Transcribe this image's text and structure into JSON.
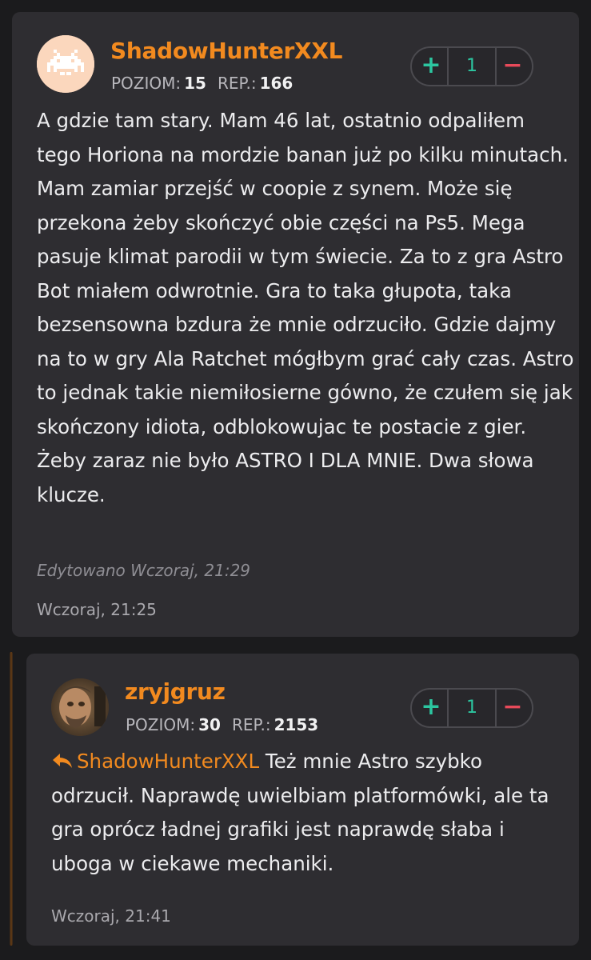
{
  "comments": [
    {
      "username": "ShadowHunterXXL",
      "avatar_icon": "space-invader-icon",
      "level_label": "POZIOM:",
      "level": "15",
      "rep_label": "REP.:",
      "rep": "166",
      "vote_count": "1",
      "vote_plus": "+",
      "vote_minus": "−",
      "text": "A gdzie tam stary. Mam 46 lat, ostatnio odpaliłem tego Horiona na mordzie banan już po kilku minutach. Mam zamiar przejść w coopie z synem. Może się przekona żeby skończyć obie części na Ps5. Mega pasuje klimat parodii w tym świecie. Za to z gra Astro Bot miałem odwrotnie. Gra to taka głupota, taka bezsensowna bzdura że mnie odrzuciło. Gdzie dajmy na to w gry Ala Ratchet mógłbym grać cały czas. Astro to jednak takie niemiłosierne gówno, że czułem się jak skończony idiota, odblokowujac te postacie z gier. Żeby zaraz nie było ASTRO I DLA MNIE. Dwa słowa klucze.",
      "edited": "Edytowano Wczoraj, 21:29",
      "timestamp": "Wczoraj, 21:25"
    },
    {
      "username": "zryjgruz",
      "avatar_icon": "user-photo-avatar",
      "level_label": "POZIOM:",
      "level": "30",
      "rep_label": "REP.:",
      "rep": "2153",
      "vote_count": "1",
      "vote_plus": "+",
      "vote_minus": "−",
      "reply_icon": "reply-arrow-icon",
      "reply_to": "ShadowHunterXXL",
      "text": "Też mnie Astro szybko odrzucił. Naprawdę uwielbiam platformówki, ale ta gra oprócz ładnej grafiki jest naprawdę słaba i uboga w ciekawe mechaniki.",
      "timestamp": "Wczoraj, 21:41"
    }
  ],
  "colors": {
    "accent": "#f28a1f",
    "upvote": "#2cc6a0",
    "downvote": "#e84a5a",
    "card": "#2e2d31",
    "background": "#1b1b1d"
  }
}
